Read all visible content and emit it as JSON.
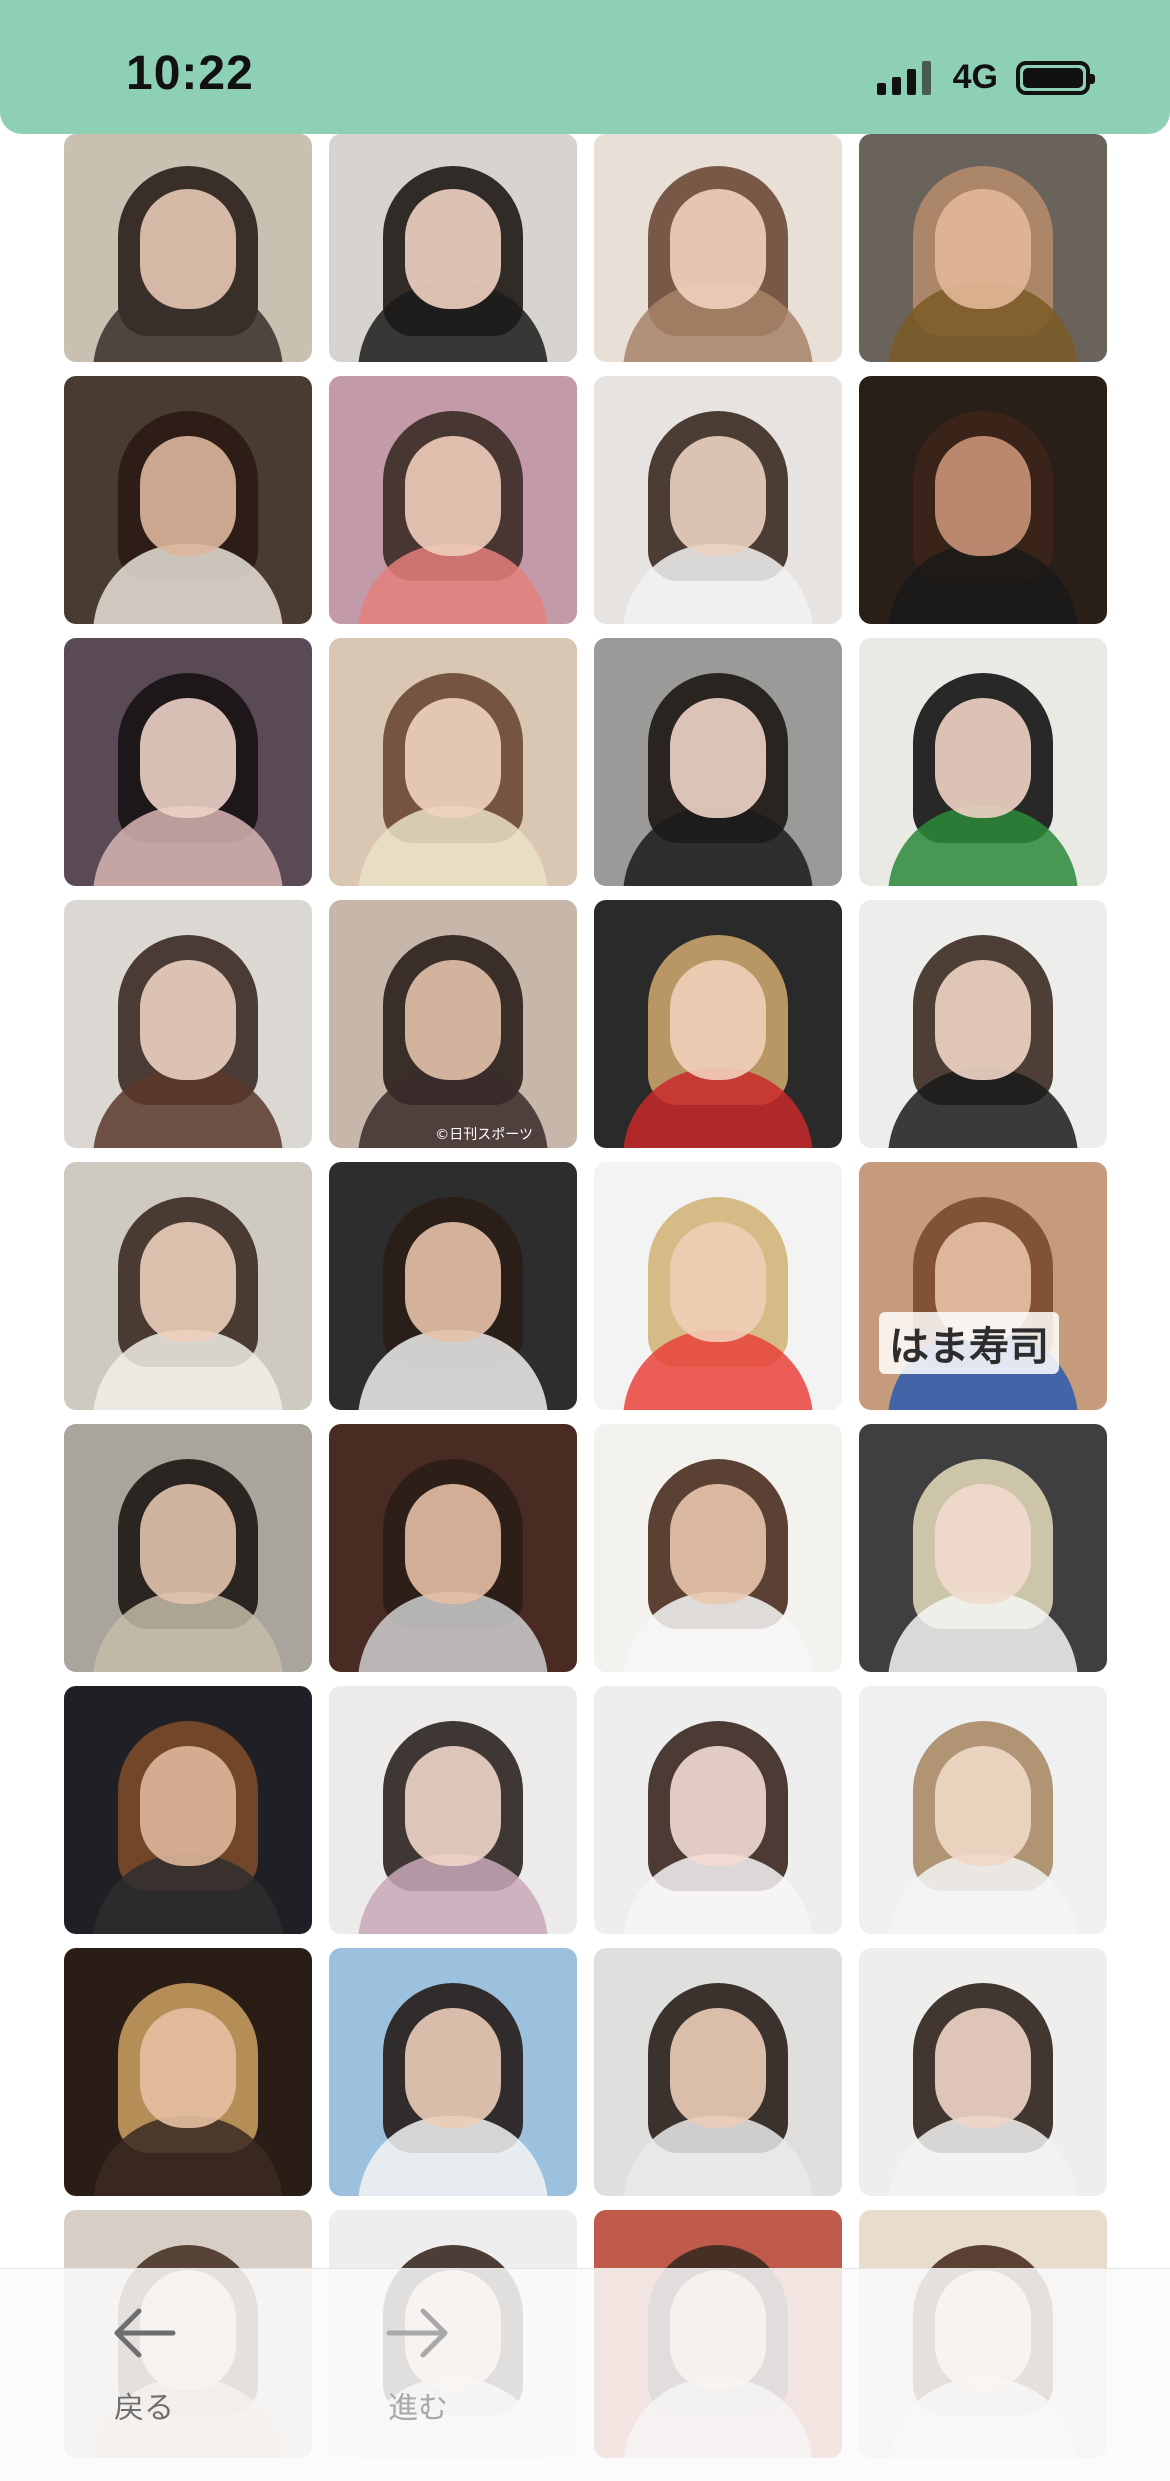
{
  "status_bar": {
    "time": "10:22",
    "network": "4G",
    "signal_bars": 3,
    "battery_level": 1.0
  },
  "grid": {
    "columns": 4,
    "tiles": [
      {
        "kind": "portrait",
        "bg": "#c9c0b1",
        "hair": "#2a1f1a",
        "skin": "#e7c8b2",
        "top": "#3a2f2a"
      },
      {
        "kind": "portrait",
        "bg": "#d7d3cf",
        "hair": "#1f1814",
        "skin": "#efd3c2",
        "top": "#1b1b1b"
      },
      {
        "kind": "portrait",
        "bg": "#e8dfd6",
        "hair": "#6b4a39",
        "skin": "#f0d2bf",
        "top": "#a78269"
      },
      {
        "kind": "portrait",
        "bg": "#6a635c",
        "hair": "#b48a6a",
        "skin": "#e3b899",
        "top": "#7a5a26"
      },
      {
        "kind": "portrait",
        "bg": "#4a3b30",
        "hair": "#2a1b14",
        "skin": "#ddb79c",
        "top": "#e8e2d7"
      },
      {
        "kind": "portrait",
        "bg": "#c39aa8",
        "hair": "#3b2b25",
        "skin": "#efcdbb",
        "top": "#e57f7c"
      },
      {
        "kind": "portrait",
        "bg": "#e6e3e0",
        "hair": "#3a2a20",
        "skin": "#ead1c0",
        "top": "#f2f2f2"
      },
      {
        "kind": "portrait",
        "bg": "#2a1e18",
        "hair": "#3c2418",
        "skin": "#c99477",
        "top": "#1a1a1a"
      },
      {
        "kind": "portrait",
        "bg": "#5a4a55",
        "hair": "#161214",
        "skin": "#ecd2c6",
        "top": "#d8b5b3"
      },
      {
        "kind": "portrait",
        "bg": "#d9c7b3",
        "hair": "#6a4833",
        "skin": "#f0d3c0",
        "top": "#e9e2c7"
      },
      {
        "kind": "portrait",
        "bg": "#9a9a98",
        "hair": "#1e1714",
        "skin": "#efd5c8",
        "top": "#1b1b1b"
      },
      {
        "kind": "portrait",
        "bg": "#eaeae4",
        "hair": "#131313",
        "skin": "#f0d2c4",
        "top": "#2b8a3a"
      },
      {
        "kind": "portrait",
        "bg": "#dbd7d2",
        "hair": "#3a2a22",
        "skin": "#ecd1c0",
        "top": "#5a3a2c"
      },
      {
        "kind": "portrait",
        "bg": "#c7b6aa",
        "hair": "#2a1f1b",
        "skin": "#e3c2ab",
        "top": "#3a2a2a",
        "caption": "©日刊スポーツ"
      },
      {
        "kind": "portrait",
        "bg": "#2a2a2a",
        "hair": "#c8a36a",
        "skin": "#efcfb8",
        "top": "#c8292a"
      },
      {
        "kind": "portrait",
        "bg": "#ededeb",
        "hair": "#3b2a22",
        "skin": "#efd5c5",
        "top": "#1a1a1a"
      },
      {
        "kind": "portrait",
        "bg": "#cfcac1",
        "hair": "#3a2a22",
        "skin": "#eccfbb",
        "top": "#f1efe8"
      },
      {
        "kind": "portrait",
        "bg": "#2d2d2d",
        "hair": "#2a1d17",
        "skin": "#e6c1aa",
        "top": "#efefef"
      },
      {
        "kind": "portrait",
        "bg": "#f3f3f3",
        "hair": "#d3b57a",
        "skin": "#efcfb6",
        "top": "#e9423a"
      },
      {
        "kind": "collage",
        "bg": "#c69b7c",
        "hair": "#7a4a2c",
        "skin": "#e7c1a6",
        "top": "#2d5ab0",
        "overlay": "はま寿司"
      },
      {
        "kind": "portrait",
        "bg": "#a9a59d",
        "hair": "#1c1713",
        "skin": "#e3c4ae",
        "top": "#c5bba9"
      },
      {
        "kind": "portrait",
        "bg": "#4a2b24",
        "hair": "#2a1d17",
        "skin": "#e4bea4",
        "top": "#cfcfcf"
      },
      {
        "kind": "portrait",
        "bg": "#f4f2ef",
        "hair": "#4a2d1e",
        "skin": "#e9c6ad",
        "top": "#f7f7f7"
      },
      {
        "kind": "portrait",
        "bg": "#3f3f42",
        "hair": "#ddd4b6",
        "skin": "#f1d9cd",
        "top": "#f4f4f4"
      },
      {
        "kind": "portrait",
        "bg": "#1f2026",
        "hair": "#7a4a2a",
        "skin": "#e0b79a",
        "top": "#2e2e2e"
      },
      {
        "kind": "portrait",
        "bg": "#ecebea",
        "hair": "#2b2320",
        "skin": "#f0d5c8",
        "top": "#c9a8b8"
      },
      {
        "kind": "portrait",
        "bg": "#eeeeee",
        "hair": "#3a2620",
        "skin": "#f3dcd2",
        "top": "#f7f5f5"
      },
      {
        "kind": "portrait",
        "bg": "#eef0f1",
        "hair": "#a88a66",
        "skin": "#f0d8c6",
        "top": "#f5f5f5"
      },
      {
        "kind": "portrait",
        "bg": "#2a1d16",
        "hair": "#c39a5e",
        "skin": "#e7c1a2",
        "top": "#3b2a22"
      },
      {
        "kind": "portrait",
        "bg": "#9bc1de",
        "hair": "#261c18",
        "skin": "#eccdb9",
        "top": "#f3f3f3"
      },
      {
        "kind": "portrait",
        "bg": "#dfe0de",
        "hair": "#2a1f1a",
        "skin": "#ebcdb8",
        "top": "#e9e9ea"
      },
      {
        "kind": "portrait",
        "bg": "#eeeeec",
        "hair": "#2d221c",
        "skin": "#f0d5c6",
        "top": "#f2f2f2"
      },
      {
        "kind": "portrait",
        "bg": "#d7cfc5",
        "hair": "#4a3426",
        "skin": "#e8c9b4",
        "top": "#c9b39e"
      },
      {
        "kind": "portrait",
        "bg": "#eeeeee",
        "hair": "#3a2a22",
        "skin": "#efd5c5",
        "top": "#e8e8e8"
      },
      {
        "kind": "portrait",
        "bg": "#c05a4a",
        "hair": "#3a2a20",
        "skin": "#e7c5b0",
        "top": "#d8d2cb"
      },
      {
        "kind": "portrait",
        "bg": "#e8dccd",
        "hair": "#4a3022",
        "skin": "#efd0bb",
        "top": "#eae6e2"
      }
    ]
  },
  "toolbar": {
    "back_label": "戻る",
    "forward_label": "進む",
    "back_enabled": true,
    "forward_enabled": false
  }
}
